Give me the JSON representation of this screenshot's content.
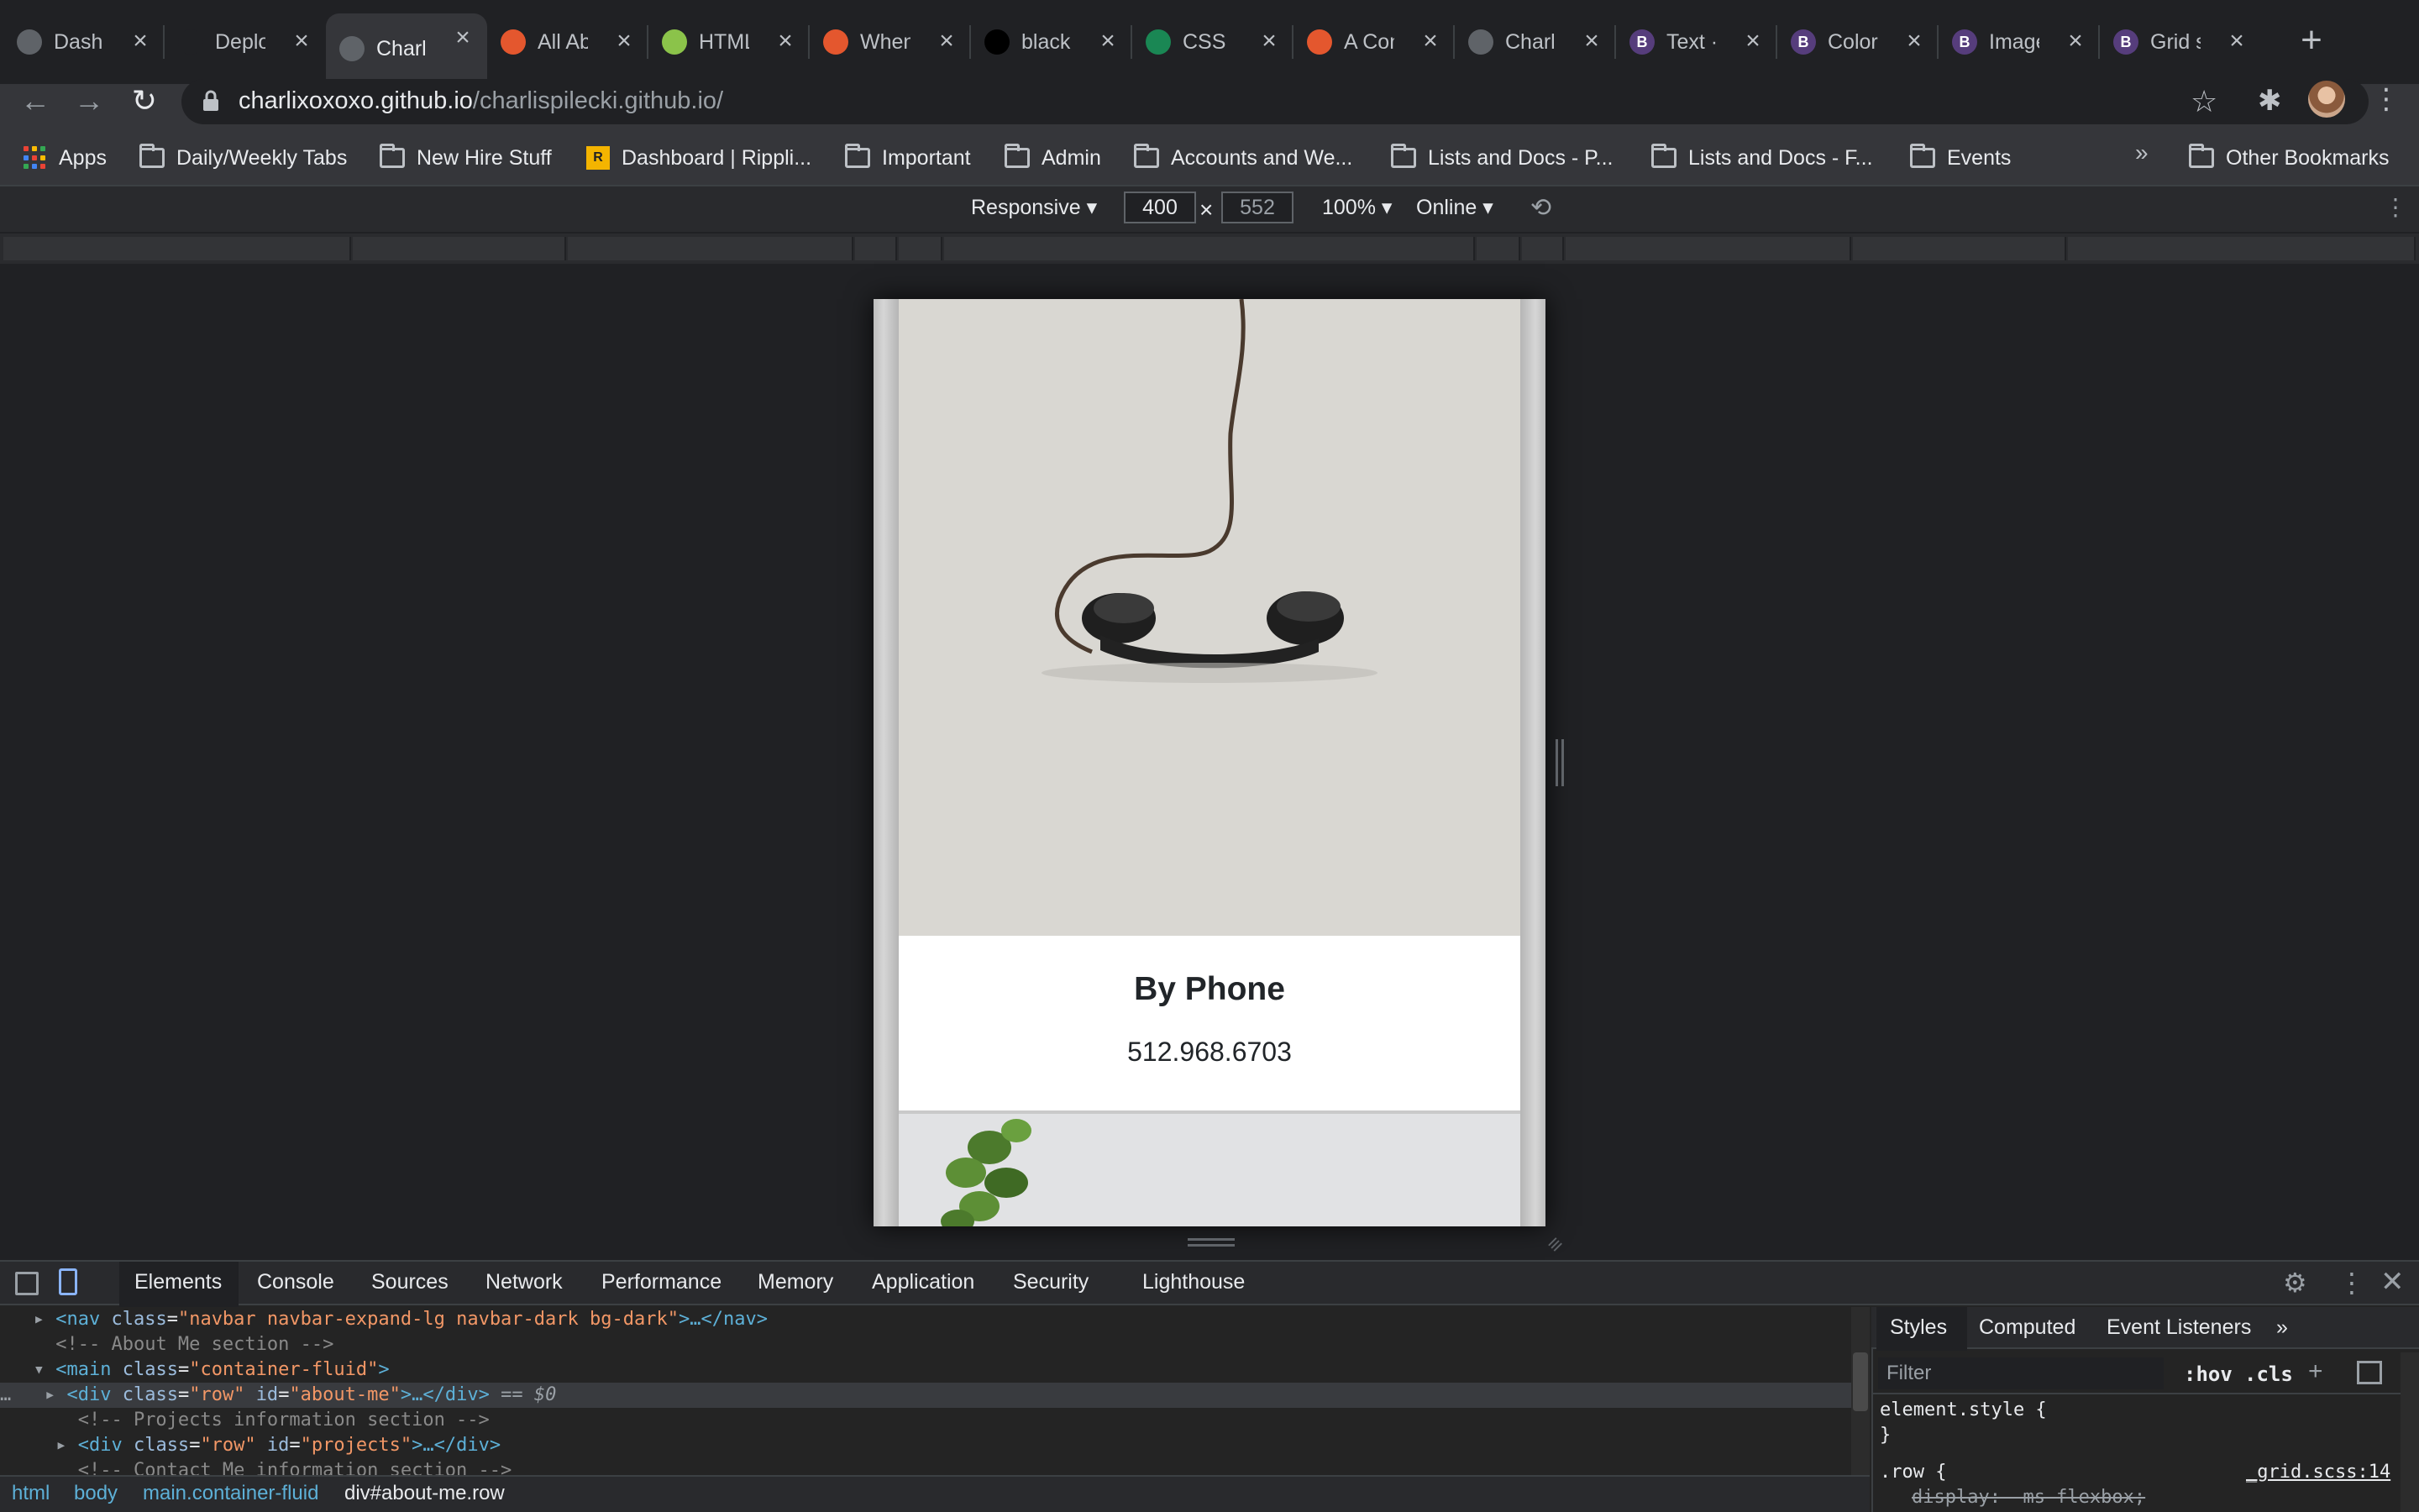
{
  "tabs": [
    {
      "title": "Dashb",
      "fav_color": "#5f6368",
      "fav_char": ""
    },
    {
      "title": "Deplo",
      "fav_color": "#202124",
      "fav_char": ""
    },
    {
      "title": "Charli",
      "fav_color": "#5f6368",
      "fav_char": "",
      "active": true
    },
    {
      "title": "All Ab",
      "fav_color": "#e4572e",
      "fav_char": ""
    },
    {
      "title": "HTML",
      "fav_color": "#8bc34a",
      "fav_char": ""
    },
    {
      "title": "When",
      "fav_color": "#e4572e",
      "fav_char": ""
    },
    {
      "title": "black",
      "fav_color": "#000000",
      "fav_char": ""
    },
    {
      "title": "CSS li",
      "fav_color": "#1a8754",
      "fav_char": ""
    },
    {
      "title": "A Con",
      "fav_color": "#e4572e",
      "fav_char": ""
    },
    {
      "title": "Charli",
      "fav_color": "#5f6368",
      "fav_char": ""
    },
    {
      "title": "Text ·",
      "fav_color": "#563d7c",
      "fav_char": "B"
    },
    {
      "title": "Colors",
      "fav_color": "#563d7c",
      "fav_char": "B"
    },
    {
      "title": "Image",
      "fav_color": "#563d7c",
      "fav_char": "B"
    },
    {
      "title": "Grid s",
      "fav_color": "#563d7c",
      "fav_char": "B"
    }
  ],
  "new_tab_icon": "+",
  "toolbar": {
    "back_icon": "←",
    "forward_icon": "→",
    "reload_icon": "↻",
    "url_host": "charlixoxoxo.github.io",
    "url_path": "/charlispilecki.github.io/",
    "star_icon": "☆",
    "extensions_icon": "✱",
    "menu_icon": "⋮"
  },
  "bookmarks": [
    {
      "label": "Apps",
      "kind": "apps"
    },
    {
      "label": "Daily/Weekly Tabs",
      "kind": "folder"
    },
    {
      "label": "New Hire Stuff",
      "kind": "folder"
    },
    {
      "label": "Dashboard | Rippli...",
      "kind": "ripple"
    },
    {
      "label": "Important",
      "kind": "folder"
    },
    {
      "label": "Admin",
      "kind": "folder"
    },
    {
      "label": "Accounts and We...",
      "kind": "folder"
    },
    {
      "label": "Lists and Docs - P...",
      "kind": "folder"
    },
    {
      "label": "Lists and Docs - F...",
      "kind": "folder"
    },
    {
      "label": "Events",
      "kind": "folder"
    }
  ],
  "bookmarks_more": "»",
  "other_bookmarks": "Other Bookmarks",
  "device_toolbar": {
    "mode": "Responsive ▾",
    "width": "400",
    "height": "552",
    "times": "×",
    "zoom": "100% ▾",
    "throttle": "Online ▾",
    "rotate_icon": "⟲",
    "more_icon": "⋮"
  },
  "page": {
    "card_title": "By Phone",
    "card_text": "512.968.6703"
  },
  "devtools": {
    "tabs": [
      "Elements",
      "Console",
      "Sources",
      "Network",
      "Performance",
      "Memory",
      "Application",
      "Security",
      "Lighthouse"
    ],
    "gear_icon": "⚙",
    "kebab_icon": "⋮",
    "close_icon": "✕",
    "dom": {
      "l1_tag_open": "<nav",
      "l1_attr": "class",
      "l1_val": "\"navbar navbar-expand-lg navbar-dark bg-dark\"",
      "l1_rest": ">…</nav>",
      "l2": "<!-- About Me section -->",
      "l3_tag_open": "<main",
      "l3_attr": "class",
      "l3_val": "\"container-fluid\"",
      "l3_rest": ">",
      "l4_tag_open": "<div",
      "l4_attr1": "class",
      "l4_val1": "\"row\"",
      "l4_attr2": "id",
      "l4_val2": "\"about-me\"",
      "l4_rest": ">…</div>",
      "l4_marker": "== $0",
      "l5": "<!-- Projects information section -->",
      "l6_tag_open": "<div",
      "l6_attr1": "class",
      "l6_val1": "\"row\"",
      "l6_attr2": "id",
      "l6_val2": "\"projects\"",
      "l6_rest": ">…</div>",
      "l7": "<!-- Contact Me information section -->"
    },
    "breadcrumb": [
      "html",
      "body",
      "main.container-fluid",
      "div#about-me.row"
    ],
    "styles": {
      "tabs": [
        "Styles",
        "Computed",
        "Event Listeners",
        "»"
      ],
      "filter_placeholder": "Filter",
      "hov": ":hov",
      "cls": ".cls",
      "plus_icon": "+",
      "rule1": "element.style {",
      "rule1_end": "}",
      "rule2": ".row {",
      "rule2_prop": "display: -ms-flexbox;",
      "rule2_src": "_grid.scss:14"
    }
  }
}
